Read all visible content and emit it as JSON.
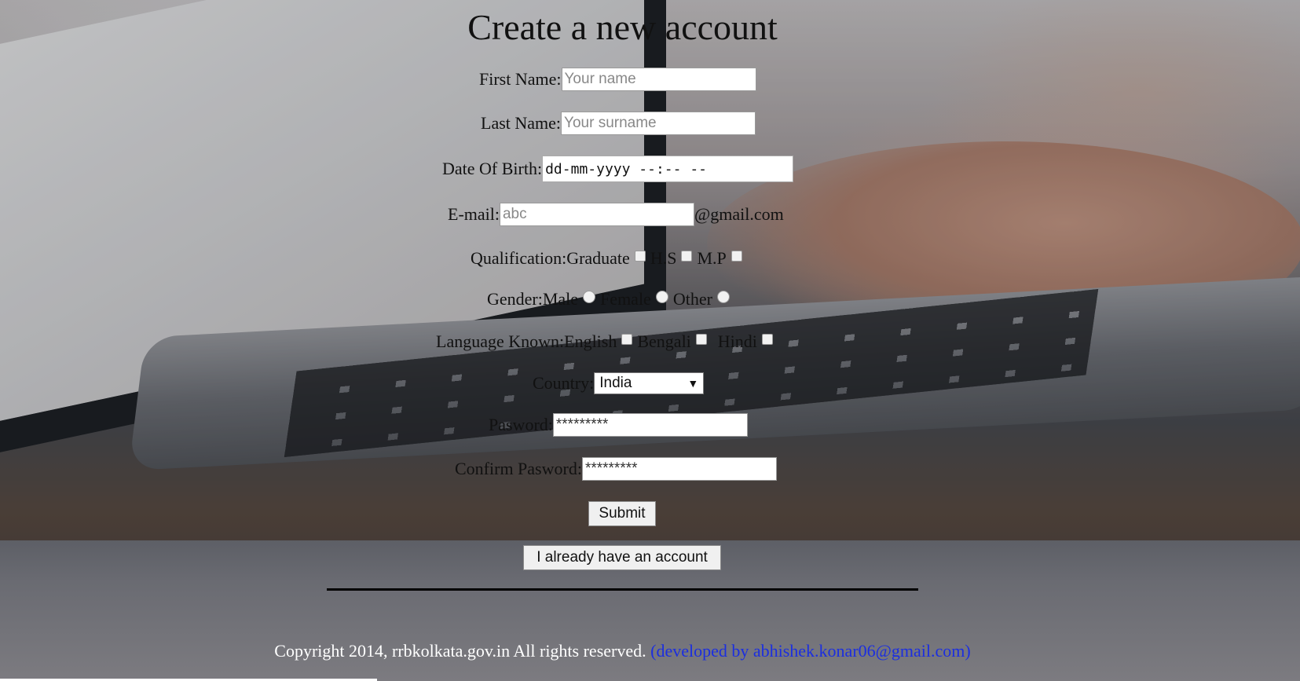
{
  "title": "Create a new account",
  "fields": {
    "first_name": {
      "label": "First Name:",
      "placeholder": "Your name"
    },
    "last_name": {
      "label": "Last Name:",
      "placeholder": "Your surname"
    },
    "dob": {
      "label": "Date Of Birth:",
      "value": "dd-mm-yyyy --:-- --"
    },
    "email": {
      "label": "E-mail:",
      "placeholder": "abc",
      "suffix": "@gmail.com"
    },
    "qualification": {
      "label": "Qualification:",
      "options": [
        "Graduate",
        "H.S",
        "M.P"
      ]
    },
    "gender": {
      "label": "Gender:",
      "options": [
        "Male",
        "Female",
        "Other"
      ]
    },
    "language": {
      "label": "Language Known:",
      "options": [
        "English",
        "Bengali",
        "Hindi"
      ]
    },
    "country": {
      "label": "Country:",
      "selected": "India"
    },
    "password": {
      "label": "Pasword:",
      "value": "*********"
    },
    "confirm_password": {
      "label": "Confirm Pasword:",
      "value": "*********"
    }
  },
  "buttons": {
    "submit": "Submit",
    "have_account": "I already have an account"
  },
  "footer": {
    "copyright": "Copyright 2014, rrbkolkata.gov.in All rights reserved.",
    "developer": "(developed by abhishek.konar06@gmail.com)"
  },
  "colors": {
    "developer_link": "#1b2ee0",
    "footer_text": "#ffffff"
  }
}
